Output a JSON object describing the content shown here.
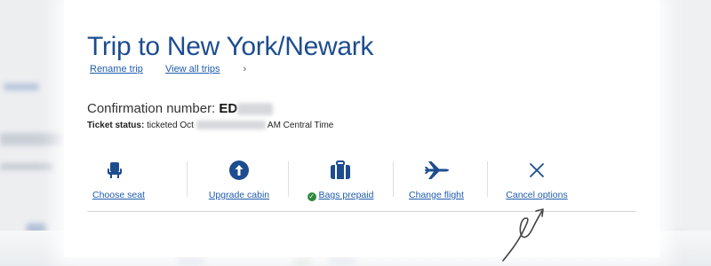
{
  "trip": {
    "title": "Trip to New York/Newark",
    "rename_link": "Rename trip",
    "view_all_link": "View all trips",
    "view_all_chevron": "›"
  },
  "confirmation": {
    "label": "Confirmation number:",
    "code_visible": "ED"
  },
  "ticket": {
    "label": "Ticket status:",
    "prefix": "ticketed Oct",
    "suffix": "AM Central Time"
  },
  "actions": [
    {
      "label": "Choose seat",
      "icon": "seat-icon"
    },
    {
      "label": "Upgrade cabin",
      "icon": "upgrade-arrow-icon"
    },
    {
      "label": "Bags prepaid",
      "icon": "luggage-icon",
      "status": "check-icon"
    },
    {
      "label": "Change flight",
      "icon": "airplane-icon"
    },
    {
      "label": "Cancel options",
      "icon": "close-icon"
    }
  ],
  "colors": {
    "brand_blue": "#1d4d8f",
    "link_blue": "#1f5cae",
    "success_green": "#2f8a3c"
  }
}
